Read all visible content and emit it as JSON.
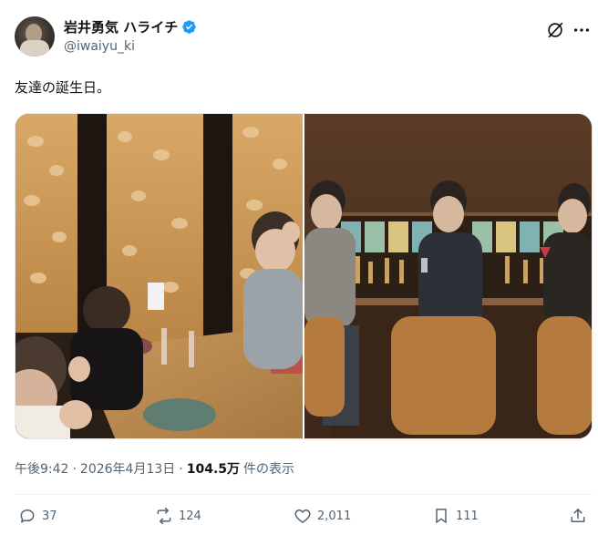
{
  "author": {
    "display_name": "岩井勇気 ハライチ",
    "handle": "@iwaiyu_ki",
    "verified": true
  },
  "tweet": {
    "text": "友達の誕生日。"
  },
  "meta": {
    "time": "午後9:42",
    "separator1": "·",
    "date": "2026年4月13日",
    "separator2": "·",
    "views_count": "104.5万",
    "views_label": "件の表示"
  },
  "actions": {
    "replies": "37",
    "reposts": "124",
    "likes": "2,011",
    "bookmarks": "111"
  },
  "icons": {
    "verified": "verified-badge-icon",
    "grok": "grok-icon",
    "more": "more-dots-icon",
    "reply": "reply-icon",
    "repost": "repost-icon",
    "like": "heart-icon",
    "bookmark": "bookmark-icon",
    "share": "share-icon"
  },
  "colors": {
    "text_primary": "#0f1419",
    "text_secondary": "#536471",
    "verified": "#1d9bf0"
  }
}
